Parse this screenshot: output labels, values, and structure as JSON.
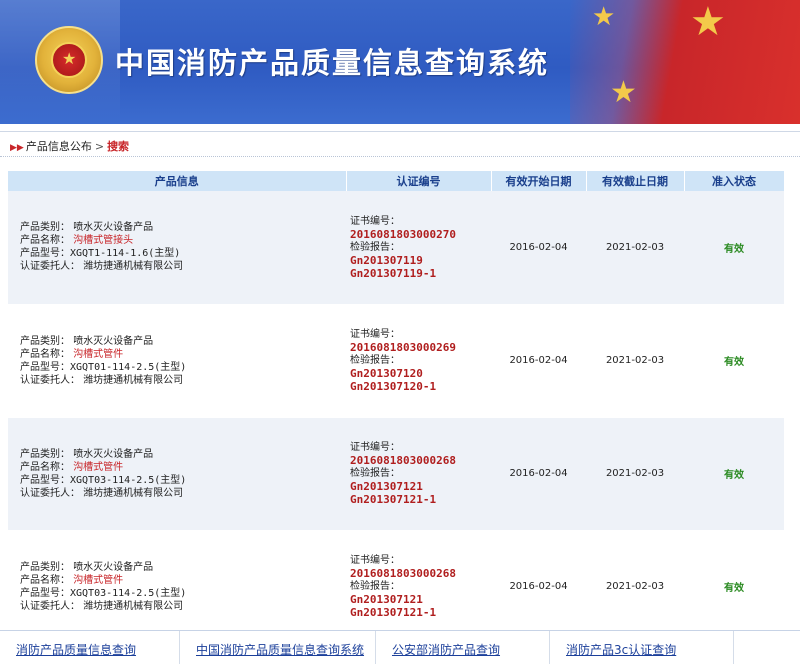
{
  "header": {
    "title": "中国消防产品质量信息查询系统"
  },
  "breadcrumb": {
    "parent": "产品信息公布",
    "separator": ">",
    "current": "搜索"
  },
  "table": {
    "headers": [
      "产品信息",
      "认证编号",
      "有效开始日期",
      "有效截止日期",
      "准入状态"
    ],
    "labels": {
      "category": "产品类别：",
      "name": "产品名称：",
      "model": "产品型号：",
      "client": "认证委托人：",
      "cert_no": "证书编号：",
      "report": "检验报告："
    },
    "rows": [
      {
        "category": "喷水灭火设备产品",
        "name": "沟槽式管接头",
        "model": "XGQT1-114-1.6(主型)",
        "client": "潍坊捷通机械有限公司",
        "cert_no": "2016081803000270",
        "report1": "Gn201307119",
        "report2": "Gn201307119-1",
        "start": "2016-02-04",
        "end": "2021-02-03",
        "status": "有效"
      },
      {
        "category": "喷水灭火设备产品",
        "name": "沟槽式管件",
        "model": "XGQT01-114-2.5(主型)",
        "client": "潍坊捷通机械有限公司",
        "cert_no": "2016081803000269",
        "report1": "Gn201307120",
        "report2": "Gn201307120-1",
        "start": "2016-02-04",
        "end": "2021-02-03",
        "status": "有效"
      },
      {
        "category": "喷水灭火设备产品",
        "name": "沟槽式管件",
        "model": "XGQT03-114-2.5(主型)",
        "client": "潍坊捷通机械有限公司",
        "cert_no": "2016081803000268",
        "report1": "Gn201307121",
        "report2": "Gn201307121-1",
        "start": "2016-02-04",
        "end": "2021-02-03",
        "status": "有效"
      },
      {
        "category": "喷水灭火设备产品",
        "name": "沟槽式管件",
        "model": "XGQT03-114-2.5(主型)",
        "client": "潍坊捷通机械有限公司",
        "cert_no": "2016081803000268",
        "report1": "Gn201307121",
        "report2": "Gn201307121-1",
        "start": "2016-02-04",
        "end": "2021-02-03",
        "status": "有效"
      }
    ]
  },
  "footer": {
    "links": [
      "消防产品质量信息查询",
      "中国消防产品质量信息查询系统",
      "公安部消防产品查询",
      "消防产品3c认证查询"
    ]
  },
  "icons": {
    "emblem": "police-emblem-icon",
    "breadcrumb_marker": "double-arrow-icon",
    "flag_stars": "star-icon"
  },
  "colors": {
    "banner_blue": "#2f5bc2",
    "accent_red": "#c8262a",
    "header_bg": "#cfe4f7",
    "status_green": "#2a8a21",
    "link_blue": "#1b3f9a"
  }
}
